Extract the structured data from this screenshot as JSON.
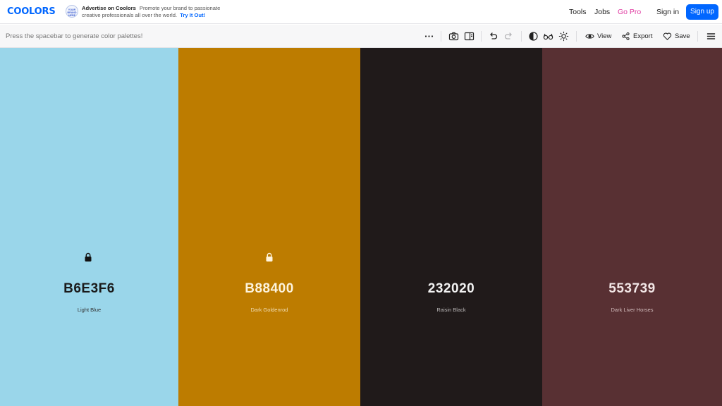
{
  "header": {
    "logo": "COOLORS",
    "ad": {
      "badge_lines": [
        "YOUR",
        "BRAND",
        "HERE"
      ],
      "title": "Advertise on Coolors",
      "text": "Promote your brand to passionate creative professionals all over the world.",
      "link": "Try It Out!"
    },
    "nav": {
      "tools": "Tools",
      "jobs": "Jobs",
      "gopro": "Go Pro",
      "signin": "Sign in",
      "signup": "Sign up"
    }
  },
  "toolbar": {
    "hint": "Press the spacebar to generate color palettes!",
    "icons": [
      "more-options-icon",
      "camera-icon",
      "side-panel-icon",
      "undo-icon",
      "redo-icon",
      "contrast-icon",
      "glasses-icon",
      "sun-icon",
      "eye-icon",
      "share-icon",
      "heart-icon",
      "hamburger-menu-icon"
    ],
    "view": "View",
    "export": "Export",
    "save": "Save"
  },
  "palette": [
    {
      "hex": "B6E3F6",
      "name": "Light Blue",
      "bg": "#9ad6ea",
      "text_color": "#1a1a1a",
      "sub_color": "#333333",
      "locked": true
    },
    {
      "hex": "B88400",
      "name": "Dark Goldenrod",
      "bg": "#bd7c00",
      "text_color": "#fdf3dc",
      "sub_color": "#f2dfb5",
      "locked": true
    },
    {
      "hex": "232020",
      "name": "Raisin Black",
      "bg": "#201a1a",
      "text_color": "#f2f2f2",
      "sub_color": "#b9b6b6",
      "locked": false
    },
    {
      "hex": "553739",
      "name": "Dark Liver Horses",
      "bg": "#583033",
      "text_color": "#f2e6e6",
      "sub_color": "#d2bcbd",
      "locked": false
    }
  ]
}
